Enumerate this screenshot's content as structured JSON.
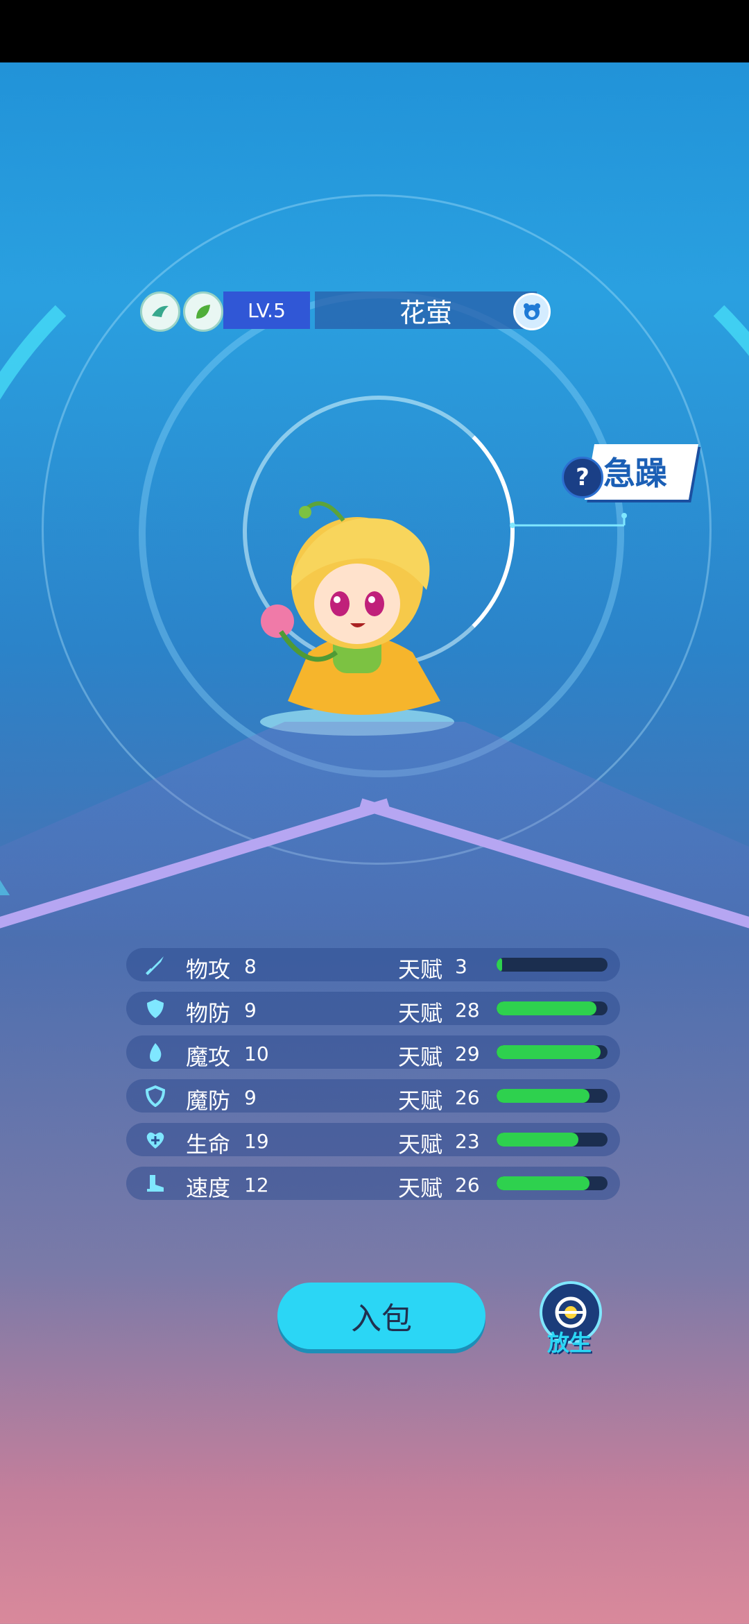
{
  "pet": {
    "level": "LV.5",
    "name": "花萤",
    "mood_tag": "急躁",
    "mood_help": "?",
    "elements": [
      "wind-icon",
      "grass-icon"
    ],
    "gender_icon": "male-icon"
  },
  "stats": [
    {
      "name": "物攻",
      "value": "8",
      "talent_label": "天赋",
      "talent": "3",
      "fill": 0.05,
      "icon": "sword-icon"
    },
    {
      "name": "物防",
      "value": "9",
      "talent_label": "天赋",
      "talent": "28",
      "fill": 0.9,
      "icon": "shield-icon"
    },
    {
      "name": "魔攻",
      "value": "10",
      "talent_label": "天赋",
      "talent": "29",
      "fill": 0.94,
      "icon": "flame-icon"
    },
    {
      "name": "魔防",
      "value": "9",
      "talent_label": "天赋",
      "talent": "26",
      "fill": 0.84,
      "icon": "magic-shield-icon"
    },
    {
      "name": "生命",
      "value": "19",
      "talent_label": "天赋",
      "talent": "23",
      "fill": 0.74,
      "icon": "heart-icon"
    },
    {
      "name": "速度",
      "value": "12",
      "talent_label": "天赋",
      "talent": "26",
      "fill": 0.84,
      "icon": "boot-icon"
    }
  ],
  "actions": {
    "bag_label": "入包",
    "release_label": "放生"
  },
  "colors": {
    "bar_fill": "#2ed14e",
    "bag_button": "#2bd6f5",
    "level_box": "#3057d6"
  }
}
